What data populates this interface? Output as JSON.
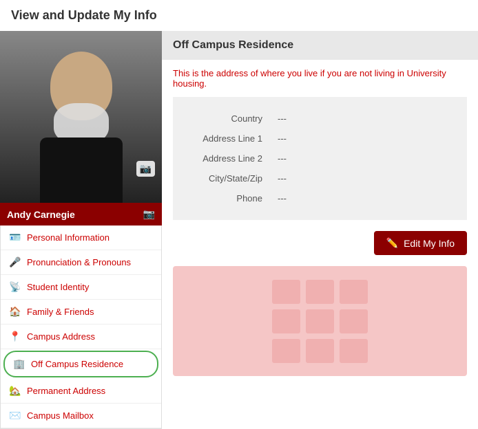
{
  "page": {
    "title": "View and Update My Info"
  },
  "sidebar": {
    "profile_name": "Andy Carnegie",
    "nav_items": [
      {
        "id": "personal-information",
        "label": "Personal Information",
        "icon": "🪪",
        "active": false
      },
      {
        "id": "pronunciation-pronouns",
        "label": "Pronunciation & Pronouns",
        "icon": "🎤",
        "active": false
      },
      {
        "id": "student-identity",
        "label": "Student Identity",
        "icon": "📡",
        "active": false
      },
      {
        "id": "family-friends",
        "label": "Family & Friends",
        "icon": "🏠",
        "active": false
      },
      {
        "id": "campus-address",
        "label": "Campus Address",
        "icon": "📍",
        "active": false
      },
      {
        "id": "off-campus-residence",
        "label": "Off Campus Residence",
        "icon": "🏢",
        "active": true
      },
      {
        "id": "permanent-address",
        "label": "Permanent Address",
        "icon": "🏡",
        "active": false
      },
      {
        "id": "campus-mailbox",
        "label": "Campus Mailbox",
        "icon": "✉️",
        "active": false
      }
    ]
  },
  "main": {
    "section_title": "Off Campus Residence",
    "info_note_prefix": "This is the address of where ",
    "info_note_highlight": "you live",
    "info_note_suffix": " if you are not living in University housing.",
    "fields": [
      {
        "label": "Country",
        "value": "---"
      },
      {
        "label": "Address Line 1",
        "value": "---"
      },
      {
        "label": "Address Line 2",
        "value": "---"
      },
      {
        "label": "City/State/Zip",
        "value": "---"
      },
      {
        "label": "Phone",
        "value": "---"
      }
    ],
    "edit_button_label": "Edit My Info"
  },
  "icons": {
    "camera": "📷",
    "edit": "✏️"
  }
}
